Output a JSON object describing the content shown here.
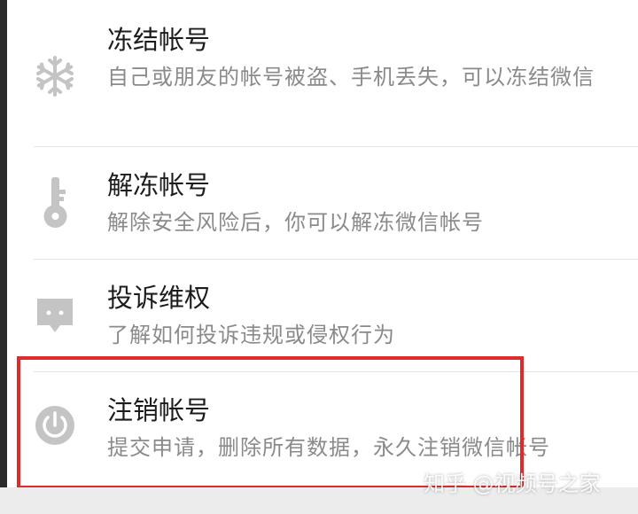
{
  "items": [
    {
      "title": "冻结帐号",
      "description": "自己或朋友的帐号被盗、手机丢失，可以冻结微信",
      "icon": "snowflake-icon"
    },
    {
      "title": "解冻帐号",
      "description": "解除安全风险后，你可以解冻微信帐号",
      "icon": "key-icon"
    },
    {
      "title": "投诉维权",
      "description": "了解如何投诉违规或侵权行为",
      "icon": "chat-bubble-icon"
    },
    {
      "title": "注销帐号",
      "description": "提交申请，删除所有数据，永久注销微信帐号",
      "icon": "power-icon"
    }
  ],
  "watermark": "知乎 @视频号之家",
  "colors": {
    "icon": "#c4c4c4",
    "title": "#1c1c1c",
    "description": "#8a8a8a",
    "highlight": "#e02b2b"
  }
}
